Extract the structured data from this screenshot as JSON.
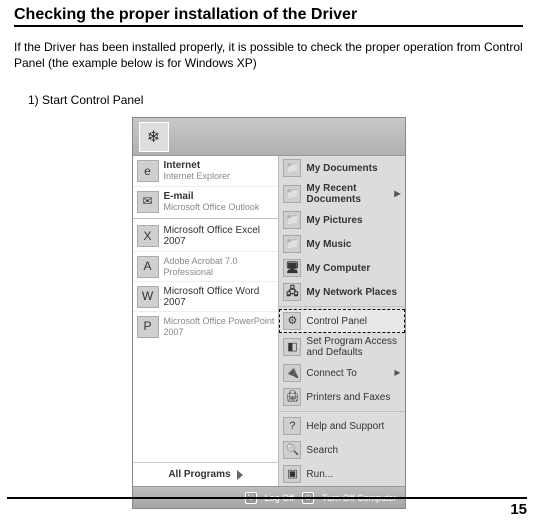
{
  "heading": "Checking the proper installation of the Driver",
  "intro": "If the Driver has been installed properly, it is possible to check the proper operation from Control Panel (the example below is for Windows XP)",
  "step1": "1) Start Control Panel",
  "page_number": "15",
  "startmenu": {
    "avatar_glyph": "❄",
    "left": {
      "internet": {
        "title": "Internet",
        "sub": "Internet Explorer"
      },
      "email": {
        "title": "E-mail",
        "sub": "Microsoft Office Outlook"
      },
      "excel": "Microsoft Office Excel 2007",
      "acrobat": {
        "title": "Adobe Acrobat 7.0",
        "sub": "Professional"
      },
      "word": "Microsoft Office Word 2007",
      "powerpoint": {
        "title": "Microsoft Office PowerPoint",
        "sub": "2007"
      },
      "all_programs": "All Programs"
    },
    "right": {
      "my_documents": "My Documents",
      "my_recent": "My Recent Documents",
      "my_pictures": "My Pictures",
      "my_music": "My Music",
      "my_computer": "My Computer",
      "my_network": "My Network Places",
      "control_panel": "Control Panel",
      "set_program": "Set Program Access and Defaults",
      "connect_to": "Connect To",
      "printers": "Printers and Faxes",
      "help": "Help and Support",
      "search": "Search",
      "run": "Run..."
    },
    "bottom": {
      "logoff": "Log Off",
      "turnoff": "Turn Off Computer"
    }
  }
}
